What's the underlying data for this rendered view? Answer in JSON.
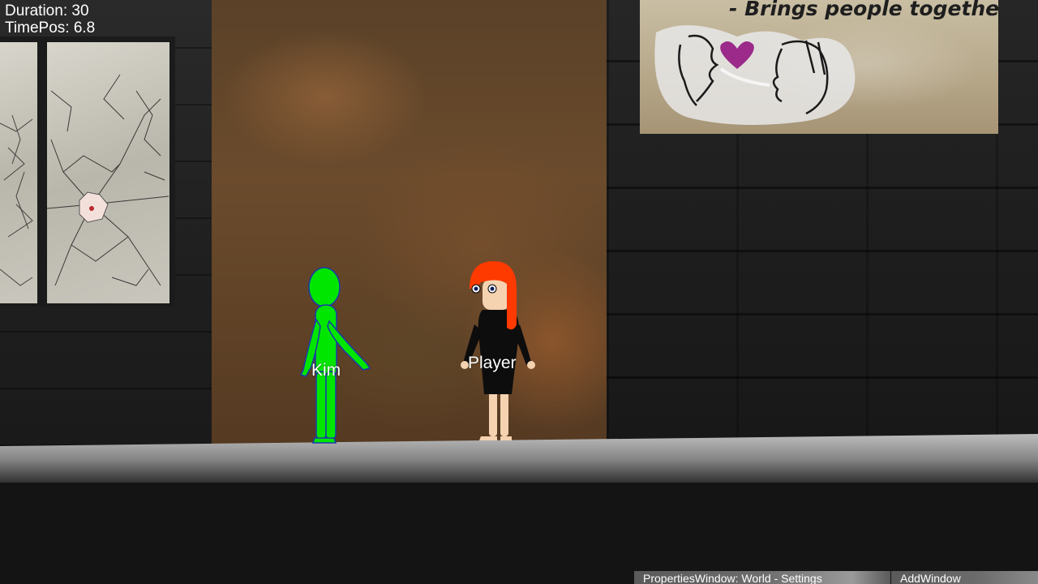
{
  "hud": {
    "duration_label": "Duration: 30",
    "timepos_label": "TimePos: 6.8"
  },
  "poster": {
    "tagline": "- Brings people together!",
    "heart_color": "#9b2a8a"
  },
  "characters": [
    {
      "name": "Kim",
      "color": "#00e600",
      "outline": "#1a3aa8"
    },
    {
      "name": "Player",
      "hair_color": "#ff3a00",
      "dress_color": "#0d0d0d",
      "skin_color": "#f5d2b0"
    }
  ],
  "editor": {
    "properties_tab": "PropertiesWindow: World - Settings",
    "add_tab": "AddWindow"
  },
  "colors": {
    "wall": "#1e1e1e",
    "backdrop": "#6b4b2c",
    "ground": "#9a9a9a",
    "floor": "#141414"
  }
}
